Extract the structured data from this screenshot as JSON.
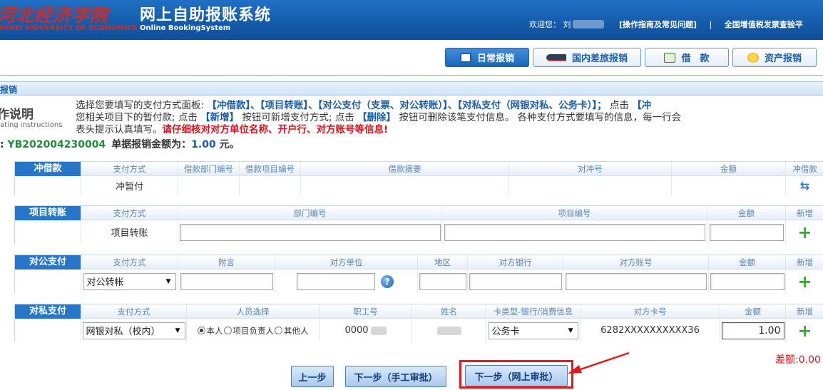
{
  "header": {
    "logo_cn": "河北经济学院",
    "logo_en": "HEBEI UNIVERSITY OF ECONOMICS",
    "title": "网上自助报账系统",
    "subtitle": "Online BookingSystem",
    "welcome": "欢迎您：",
    "user_name_prefix": "刘",
    "help_link": "[操作指南及常见问题]",
    "separator": "|",
    "vat_link": "全国增值税发票查验平"
  },
  "nav": {
    "tabs": [
      {
        "label": "日常报销",
        "icon": "list-icon",
        "active": true
      },
      {
        "label": "国内差旅报销",
        "icon": "train-icon",
        "active": false
      },
      {
        "label": "借　款",
        "icon": "loan-icon",
        "active": false
      },
      {
        "label": "资产报销",
        "icon": "coin-icon",
        "active": false
      }
    ]
  },
  "section": {
    "title": "报销"
  },
  "instructions": {
    "label": "作说明",
    "sublabel": "rating instructions",
    "line1_pre": "选择您要填写的支付方式面板: ",
    "line1_hl": "【冲借款】、【项目转账】、【对公支付（支票、对公转账）】、【对私支付（网银对私、公务卡）】；",
    "line1_post": " 点击 ",
    "line1_tail": "【冲",
    "line2_a": "您相关项目下的暂付款; 点击 ",
    "line2_hl1": "【新增】",
    "line2_b": " 按钮可新增支付方式; 点击 ",
    "line2_hl2": "【删除】",
    "line2_c": " 按钮可删除该笔支付信息。 各种支付方式要填写的信息，每一行会",
    "line3_a": "表头提示认真填写。",
    "line3_warn": "请仔细核对对方单位名称、开户行、对方账号等信息!"
  },
  "order": {
    "prefix": ": ",
    "number": "YB202004230004",
    "amount_label": "单据报销金额为：",
    "amount": "1.00",
    "unit": " 元。"
  },
  "offset_loan": {
    "label": "冲借款",
    "headers": [
      "支付方式",
      "借款部门编号",
      "借款项目编号",
      "借款摘要",
      "对冲号",
      "金额",
      "冲借款"
    ],
    "method": "冲暂付"
  },
  "project_transfer": {
    "label": "项目转账",
    "headers": [
      "支付方式",
      "部门编号",
      "项目编号",
      "金额",
      "新增"
    ],
    "method": "项目转账"
  },
  "public_pay": {
    "label": "对公支付",
    "headers": [
      "支付方式",
      "附言",
      "对方单位",
      "地区",
      "对方银行",
      "对方账号",
      "金额",
      "新增"
    ],
    "method": "对公转帐",
    "help_glyph": "?"
  },
  "private_pay": {
    "label": "对私支付",
    "headers": [
      "支付方式",
      "人员选择",
      "职工号",
      "姓名",
      "卡类型-银行/消费信息",
      "对方卡号",
      "金额",
      "新增"
    ],
    "method": "网银对私（校内）",
    "radio_options": [
      "本人",
      "项目负责人",
      "其他人"
    ],
    "employee_no": "0000",
    "card_type": "公务卡",
    "card_no": "6282XXXXXXXXXX36",
    "amount": "1.00"
  },
  "footer": {
    "difference": "差额:0.00",
    "prev_button": "上一步",
    "next_manual_button": "下一步（手工审批）",
    "next_online_button": "下一步（网上审批）"
  },
  "colors": {
    "header_blue": "#155cac",
    "accent_red": "#e0101a",
    "label_blue": "#2677c9",
    "plus_green": "#3aa735"
  }
}
